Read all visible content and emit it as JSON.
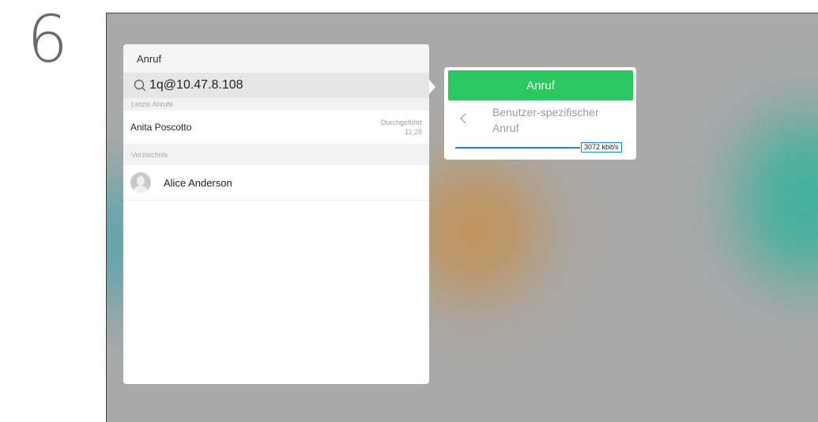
{
  "step_number": "6",
  "colors": {
    "call_button": "#2bc760",
    "bitrate_accent": "#1e88d8",
    "screen_background": "#a9a9a9"
  },
  "left_panel": {
    "title": "Anruf",
    "search": {
      "icon": "search-icon",
      "value": "1q@10.47.8.108"
    },
    "recent_header": "Letzte Anrufe",
    "recent_calls": [
      {
        "name": "Anita Poscotto",
        "status": "Durchgeführt",
        "time": "11:28"
      }
    ],
    "directory_header": "Verzeichnis",
    "directory": [
      {
        "name": "Alice Anderson",
        "icon": "avatar-icon"
      }
    ]
  },
  "call_panel": {
    "call_button_label": "Anruf",
    "back_icon": "chevron-left-icon",
    "custom_call_label": "Benutzer-spezifischer Anruf",
    "bitrate": {
      "label": "3072 kbit/s",
      "fraction": 1.0
    }
  }
}
